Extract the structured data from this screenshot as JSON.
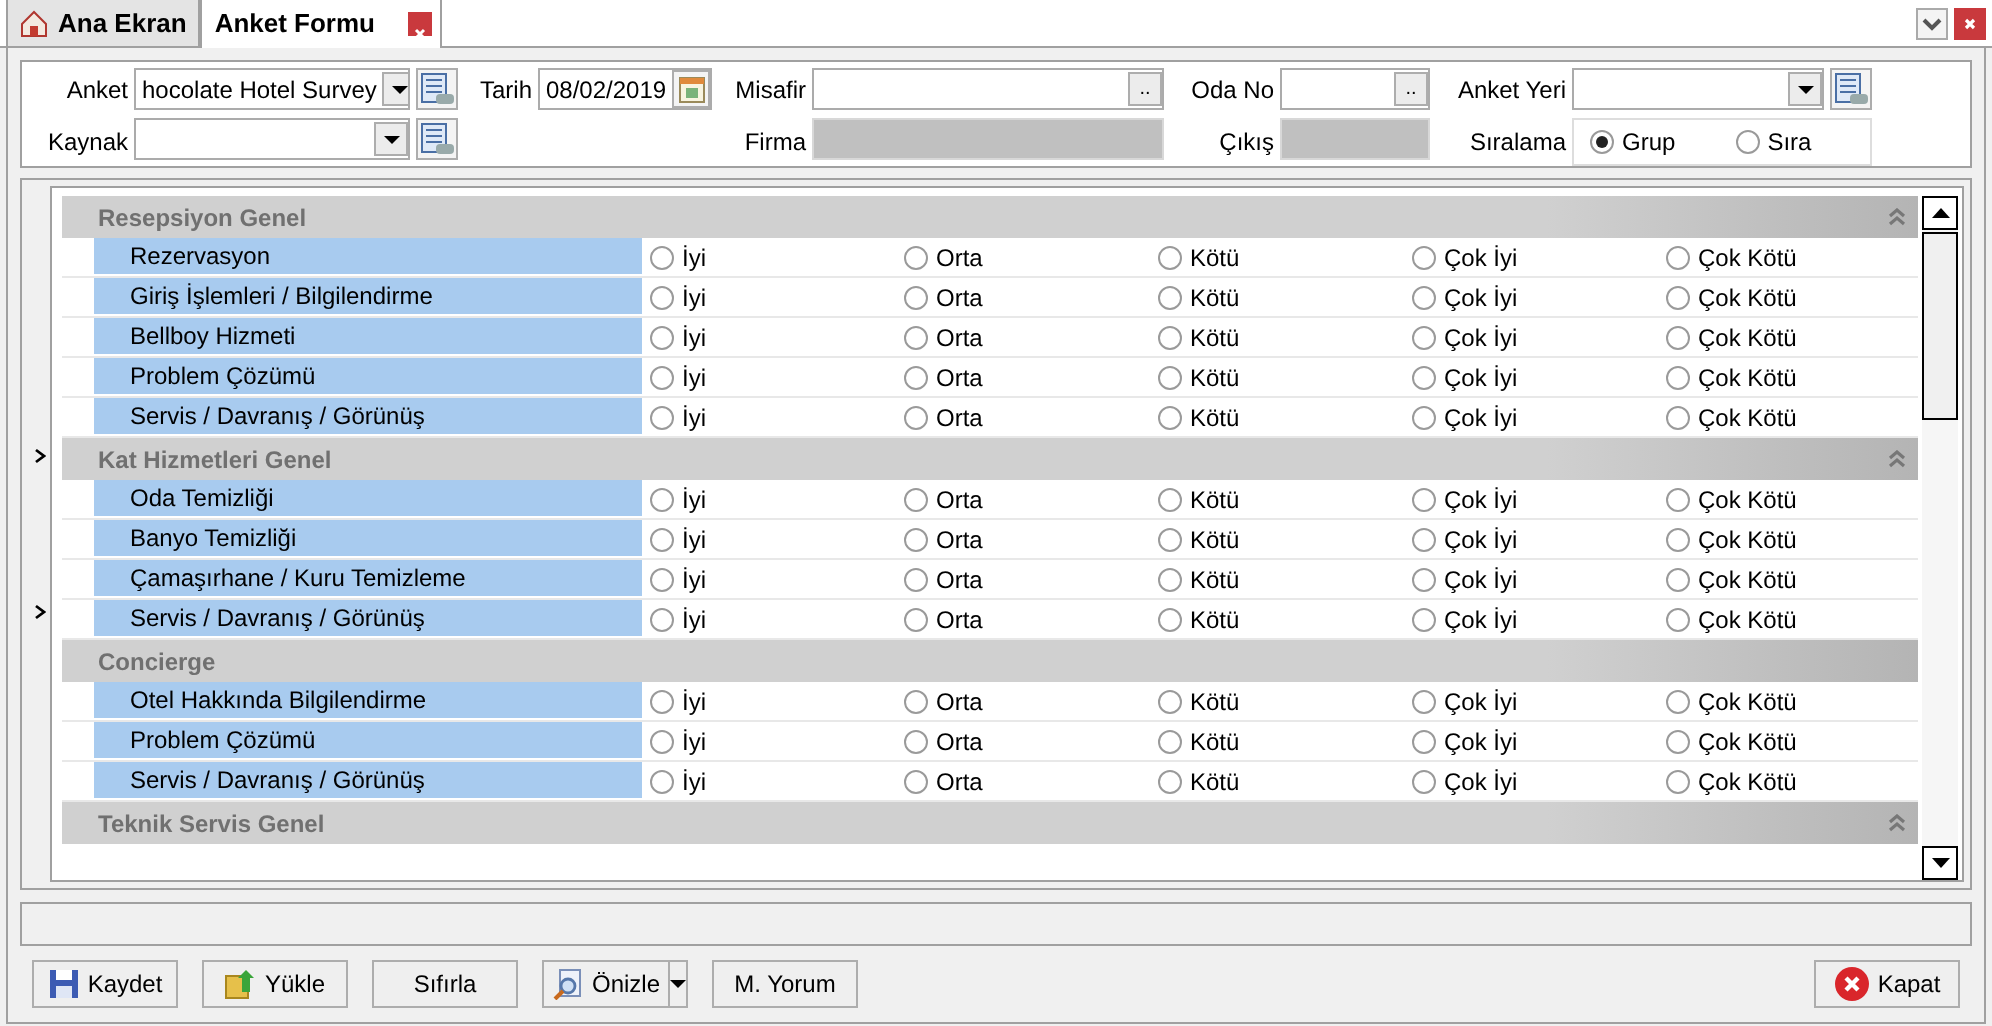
{
  "tabs": [
    {
      "label": "Ana Ekran",
      "selected": false,
      "kind": "home"
    },
    {
      "label": "Anket Formu",
      "selected": true,
      "kind": "closable"
    }
  ],
  "form": {
    "rows": [
      [
        {
          "label": "Anket",
          "kind": "combo",
          "value": "hocolate Hotel Survey"
        },
        {
          "label": "Tarih",
          "kind": "date",
          "value": "08/02/2019"
        },
        {
          "label": "Misafir",
          "kind": "lookup",
          "button_text": ".."
        },
        {
          "label": "Oda No",
          "kind": "lookup",
          "button_text": ".."
        },
        {
          "label": "Anket Yeri",
          "kind": "combo"
        }
      ],
      [
        {
          "label": "Kaynak",
          "kind": "combo"
        },
        "",
        {
          "label": "Firma",
          "kind": "readonly"
        },
        {
          "label": "Çıkış",
          "kind": "readonly"
        },
        {
          "label": "Sıralama",
          "kind": "radio",
          "options": [
            {
              "label": "Grup",
              "selected": true
            },
            {
              "label": "Sıra",
              "selected": false
            }
          ]
        }
      ]
    ]
  },
  "survey": {
    "groups": [
      {
        "title": "Resepsiyon Genel",
        "collapsible": true,
        "questions": [
          {
            "label": "Rezervasyon",
            "options": [
              {
                "label": "İyi",
                "selected": false
              },
              {
                "label": "Orta",
                "selected": false
              },
              {
                "label": "Kötü",
                "selected": false
              },
              {
                "label": "Çok İyi",
                "selected": false
              },
              {
                "label": "Çok Kötü",
                "selected": false
              }
            ]
          },
          {
            "label": "Giriş İşlemleri / Bilgilendirme",
            "options": [
              {
                "label": "İyi",
                "selected": false
              },
              {
                "label": "Orta",
                "selected": false
              },
              {
                "label": "Kötü",
                "selected": false
              },
              {
                "label": "Çok İyi",
                "selected": false
              },
              {
                "label": "Çok Kötü",
                "selected": false
              }
            ]
          },
          {
            "label": "Bellboy Hizmeti",
            "options": [
              {
                "label": "İyi",
                "selected": false
              },
              {
                "label": "Orta",
                "selected": false
              },
              {
                "label": "Kötü",
                "selected": false
              },
              {
                "label": "Çok İyi",
                "selected": false
              },
              {
                "label": "Çok Kötü",
                "selected": false
              }
            ]
          },
          {
            "label": "Problem Çözümü",
            "options": [
              {
                "label": "İyi",
                "selected": false
              },
              {
                "label": "Orta",
                "selected": false
              },
              {
                "label": "Kötü",
                "selected": false
              },
              {
                "label": "Çok İyi",
                "selected": false
              },
              {
                "label": "Çok Kötü",
                "selected": false
              }
            ]
          },
          {
            "label": "Servis / Davranış / Görünüş",
            "options": [
              {
                "label": "İyi",
                "selected": false
              },
              {
                "label": "Orta",
                "selected": false
              },
              {
                "label": "Kötü",
                "selected": false
              },
              {
                "label": "Çok İyi",
                "selected": false
              },
              {
                "label": "Çok Kötü",
                "selected": false
              }
            ]
          }
        ]
      },
      {
        "title": "Kat Hizmetleri Genel",
        "collapsible": true,
        "questions": [
          {
            "label": "Oda Temizliği",
            "options": [
              {
                "label": "İyi",
                "selected": false
              },
              {
                "label": "Orta",
                "selected": false
              },
              {
                "label": "Kötü",
                "selected": false
              },
              {
                "label": "Çok İyi",
                "selected": false
              },
              {
                "label": "Çok Kötü",
                "selected": false
              }
            ]
          },
          {
            "label": "Banyo Temizliği",
            "options": [
              {
                "label": "İyi",
                "selected": false
              },
              {
                "label": "Orta",
                "selected": false
              },
              {
                "label": "Kötü",
                "selected": false
              },
              {
                "label": "Çok İyi",
                "selected": false
              },
              {
                "label": "Çok Kötü",
                "selected": false
              }
            ]
          },
          {
            "label": "Çamaşırhane / Kuru Temizleme",
            "options": [
              {
                "label": "İyi",
                "selected": false
              },
              {
                "label": "Orta",
                "selected": false
              },
              {
                "label": "Kötü",
                "selected": false
              },
              {
                "label": "Çok İyi",
                "selected": false
              },
              {
                "label": "Çok Kötü",
                "selected": false
              }
            ]
          },
          {
            "label": "Servis / Davranış / Görünüş",
            "options": [
              {
                "label": "İyi",
                "selected": false
              },
              {
                "label": "Orta",
                "selected": false
              },
              {
                "label": "Kötü",
                "selected": false
              },
              {
                "label": "Çok İyi",
                "selected": false
              },
              {
                "label": "Çok Kötü",
                "selected": false
              }
            ]
          }
        ]
      },
      {
        "title": "Concierge",
        "collapsible": false,
        "questions": [
          {
            "label": "Otel Hakkında Bilgilendirme",
            "options": [
              {
                "label": "İyi",
                "selected": false
              },
              {
                "label": "Orta",
                "selected": false
              },
              {
                "label": "Kötü",
                "selected": false
              },
              {
                "label": "Çok İyi",
                "selected": false
              },
              {
                "label": "Çok Kötü",
                "selected": false
              }
            ]
          },
          {
            "label": "Problem Çözümü",
            "options": [
              {
                "label": "İyi",
                "selected": false
              },
              {
                "label": "Orta",
                "selected": false
              },
              {
                "label": "Kötü",
                "selected": false
              },
              {
                "label": "Çok İyi",
                "selected": false
              },
              {
                "label": "Çok Kötü",
                "selected": false
              }
            ]
          },
          {
            "label": "Servis / Davranış / Görünüş",
            "options": [
              {
                "label": "İyi",
                "selected": false
              },
              {
                "label": "Orta",
                "selected": false
              },
              {
                "label": "Kötü",
                "selected": false
              },
              {
                "label": "Çok İyi",
                "selected": false
              },
              {
                "label": "Çok Kötü",
                "selected": false
              }
            ]
          }
        ]
      },
      {
        "title": "Teknik Servis Genel",
        "collapsible": true
      }
    ]
  },
  "buttons": [
    {
      "label": "Kaydet",
      "kind": "save"
    },
    {
      "label": "Yükle",
      "kind": "load"
    },
    {
      "label": "Sıfırla",
      "kind": "plain"
    },
    {
      "label": "Önizle",
      "kind": "preview"
    },
    {
      "label": "M. Yorum",
      "kind": "plain"
    }
  ],
  "close_button": {
    "label": "Kapat"
  }
}
